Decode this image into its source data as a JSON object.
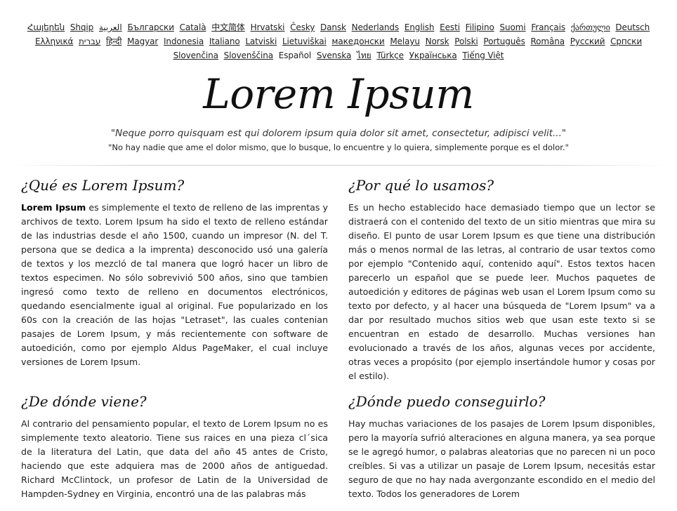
{
  "languages": [
    {
      "label": "Հայերեն",
      "current": false
    },
    {
      "label": "Shqip",
      "current": false
    },
    {
      "label": "العربية",
      "current": false
    },
    {
      "label": "Български",
      "current": false
    },
    {
      "label": "Català",
      "current": false
    },
    {
      "label": "中文简体",
      "current": false
    },
    {
      "label": "Hrvatski",
      "current": false
    },
    {
      "label": "Česky",
      "current": false
    },
    {
      "label": "Dansk",
      "current": false
    },
    {
      "label": "Nederlands",
      "current": false
    },
    {
      "label": "English",
      "current": false
    },
    {
      "label": "Eesti",
      "current": false
    },
    {
      "label": "Filipino",
      "current": false
    },
    {
      "label": "Suomi",
      "current": false
    },
    {
      "label": "Français",
      "current": false
    },
    {
      "label": "ქართული",
      "current": false
    },
    {
      "label": "Deutsch",
      "current": false
    },
    {
      "label": "Ελληνικά",
      "current": false
    },
    {
      "label": "עברית",
      "current": false
    },
    {
      "label": "हिन्दी",
      "current": false
    },
    {
      "label": "Magyar",
      "current": false
    },
    {
      "label": "Indonesia",
      "current": false
    },
    {
      "label": "Italiano",
      "current": false
    },
    {
      "label": "Latviski",
      "current": false
    },
    {
      "label": "Lietuviškai",
      "current": false
    },
    {
      "label": "македонски",
      "current": false
    },
    {
      "label": "Melayu",
      "current": false
    },
    {
      "label": "Norsk",
      "current": false
    },
    {
      "label": "Polski",
      "current": false
    },
    {
      "label": "Português",
      "current": false
    },
    {
      "label": "Româna",
      "current": false
    },
    {
      "label": "Pyccкий",
      "current": false
    },
    {
      "label": "Српски",
      "current": false
    },
    {
      "label": "Slovenčina",
      "current": false
    },
    {
      "label": "Slovenščina",
      "current": false
    },
    {
      "label": "Español",
      "current": true
    },
    {
      "label": "Svenska",
      "current": false
    },
    {
      "label": "ไทย",
      "current": false
    },
    {
      "label": "Türkçe",
      "current": false
    },
    {
      "label": "Українська",
      "current": false
    },
    {
      "label": "Tiếng Việt",
      "current": false
    }
  ],
  "banner": {
    "title": "Lorem Ipsum",
    "quote": "\"Neque porro quisquam est qui dolorem ipsum quia dolor sit amet, consectetur, adipisci velit...\"",
    "translation": "\"No hay nadie que ame el dolor mismo, que lo busque, lo encuentre y lo quiera, simplemente porque es el dolor.\""
  },
  "sections": {
    "what": {
      "heading": "¿Qué es Lorem Ipsum?",
      "bold": "Lorem Ipsum",
      "body": " es simplemente el texto de relleno de las imprentas y archivos de texto. Lorem Ipsum ha sido el texto de relleno estándar de las industrias desde el año 1500, cuando un impresor (N. del T. persona que se dedica a la imprenta) desconocido usó una galería de textos y los mezcló de tal manera que logró hacer un libro de textos especimen. No sólo sobrevivió 500 años, sino que tambien ingresó como texto de relleno en documentos electrónicos, quedando esencialmente igual al original. Fue popularizado en los 60s con la creación de las hojas \"Letraset\", las cuales contenian pasajes de Lorem Ipsum, y más recientemente con software de autoedición, como por ejemplo Aldus PageMaker, el cual incluye versiones de Lorem Ipsum."
    },
    "why": {
      "heading": "¿Por qué lo usamos?",
      "body": "Es un hecho establecido hace demasiado tiempo que un lector se distraerá con el contenido del texto de un sitio mientras que mira su diseño. El punto de usar Lorem Ipsum es que tiene una distribución más o menos normal de las letras, al contrario de usar textos como por ejemplo \"Contenido aquí, contenido aquí\". Estos textos hacen parecerlo un español que se puede leer. Muchos paquetes de autoedición y editores de páginas web usan el Lorem Ipsum como su texto por defecto, y al hacer una búsqueda de \"Lorem Ipsum\" va a dar por resultado muchos sitios web que usan este texto si se encuentran en estado de desarrollo. Muchas versiones han evolucionado a través de los años, algunas veces por accidente, otras veces a propósito (por ejemplo insertándole humor y cosas por el estilo)."
    },
    "where_from": {
      "heading": "¿De dónde viene?",
      "body": "Al contrario del pensamiento popular, el texto de Lorem Ipsum no es simplemente texto aleatorio. Tiene sus raices en una pieza cl´sica de la literatura del Latin, que data del año 45 antes de Cristo, haciendo que este adquiera mas de 2000 años de antiguedad. Richard McClintock, un profesor de Latin de la Universidad de Hampden-Sydney en Virginia, encontró una de las palabras más"
    },
    "where_get": {
      "heading": "¿Dónde puedo conseguirlo?",
      "body": "Hay muchas variaciones de los pasajes de Lorem Ipsum disponibles, pero la mayoría sufrió alteraciones en alguna manera, ya sea porque se le agregó humor, o palabras aleatorias que no parecen ni un poco creíbles. Si vas a utilizar un pasaje de Lorem Ipsum, necesitás estar seguro de que no hay nada avergonzante escondido en el medio del texto. Todos los generadores de Lorem"
    }
  }
}
